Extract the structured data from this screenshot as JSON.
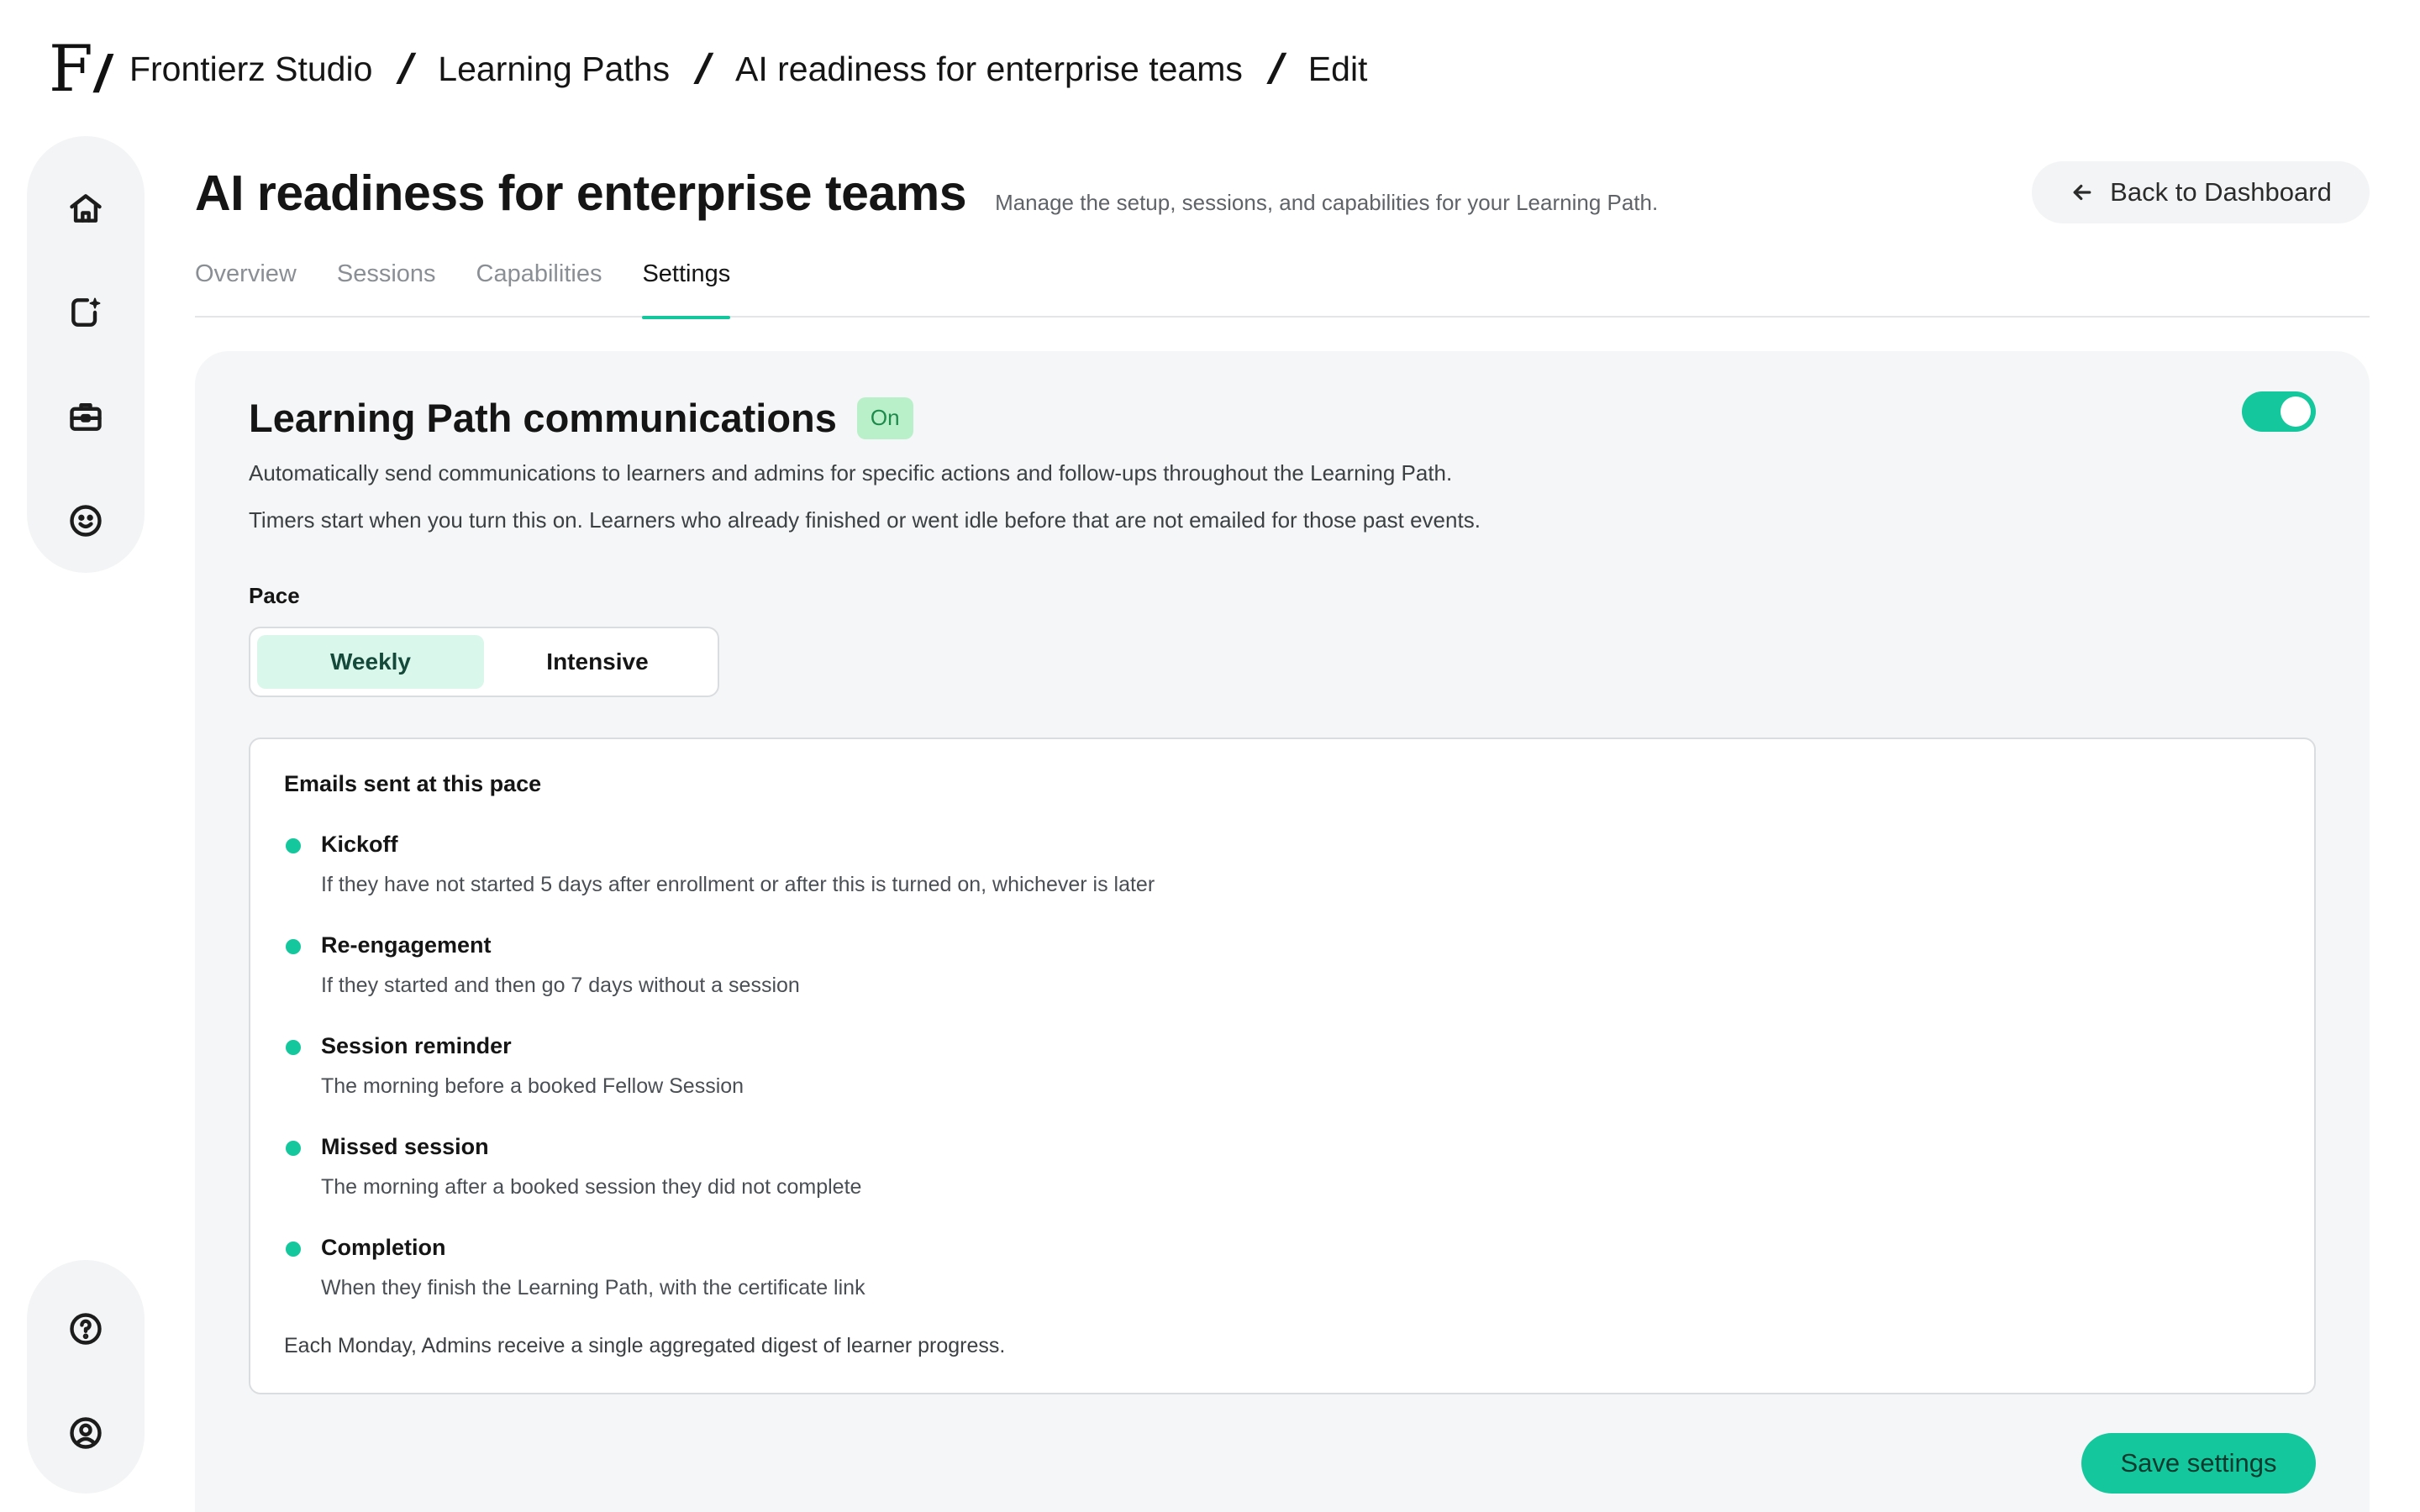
{
  "breadcrumb": {
    "logo": "F",
    "items": [
      "Frontierz Studio",
      "Learning Paths",
      "AI readiness for enterprise teams",
      "Edit"
    ],
    "separator": "/"
  },
  "sidebar": {
    "top_icons": [
      "home-icon",
      "new-document-sparkle-icon",
      "briefcase-icon",
      "smiley-icon"
    ],
    "bottom_icons": [
      "help-icon",
      "account-icon"
    ]
  },
  "header": {
    "title": "AI readiness for enterprise teams",
    "subtitle": "Manage the setup, sessions, and capabilities for your Learning Path.",
    "back_button": "Back to Dashboard"
  },
  "tabs": [
    {
      "label": "Overview",
      "active": false
    },
    {
      "label": "Sessions",
      "active": false
    },
    {
      "label": "Capabilities",
      "active": false
    },
    {
      "label": "Settings",
      "active": true
    }
  ],
  "communications": {
    "title": "Learning Path communications",
    "status": "On",
    "enabled": true,
    "description_1": "Automatically send communications to learners and admins for specific actions and follow-ups throughout the Learning Path.",
    "description_2": "Timers start when you turn this on. Learners who already finished or went idle before that are not emailed for those past events.",
    "pace_label": "Pace",
    "pace_options": [
      "Weekly",
      "Intensive"
    ],
    "pace_selected": "Weekly",
    "emails_title": "Emails sent at this pace",
    "emails": [
      {
        "name": "Kickoff",
        "desc": "If they have not started 5 days after enrollment or after this is turned on, whichever is later"
      },
      {
        "name": "Re-engagement",
        "desc": "If they started and then go 7 days without a session"
      },
      {
        "name": "Session reminder",
        "desc": "The morning before a booked Fellow Session"
      },
      {
        "name": "Missed session",
        "desc": "The morning after a booked session they did not complete"
      },
      {
        "name": "Completion",
        "desc": "When they finish the Learning Path, with the certificate link"
      }
    ],
    "digest_note": "Each Monday, Admins receive a single aggregated digest of learner progress.",
    "save_button": "Save settings"
  },
  "colors": {
    "accent": "#14c79c",
    "badge_bg": "#b9f0c9",
    "badge_text": "#1d8a4a",
    "card_bg": "#f5f6f7"
  }
}
